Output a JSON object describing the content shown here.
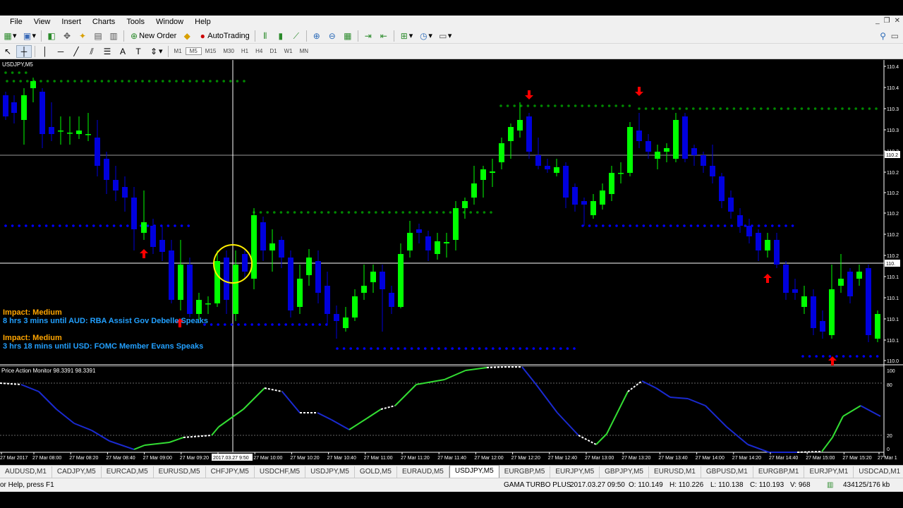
{
  "menu": [
    "File",
    "View",
    "Insert",
    "Charts",
    "Tools",
    "Window",
    "Help"
  ],
  "toolbar": {
    "new_order": "New Order",
    "auto_trading": "AutoTrading"
  },
  "timeframes": [
    "M1",
    "M5",
    "M15",
    "M30",
    "H1",
    "H4",
    "D1",
    "W1",
    "MN"
  ],
  "chart": {
    "symbol_label": "USDJPY,M5",
    "indicator_label": "Price Action Monitor 98.3391 98.3391",
    "news": [
      {
        "impact": "Impact: Medium",
        "text": "8 hrs 3 mins until AUD: RBA Assist Gov Debelle Speaks"
      },
      {
        "impact": "Impact: Medium",
        "text": "3 hrs 18 mins until USD: FOMC Member Evans Speaks"
      }
    ],
    "price_labels": [
      "110.4",
      "110.4",
      "110.3",
      "110.3",
      "110.2",
      "110.2",
      "110.2",
      "110.2",
      "110.2",
      "110.2",
      "110.1",
      "110.1",
      "110.1",
      "110.1",
      "110.0"
    ],
    "crosshair_price_label": "110.",
    "bid_price_label": "110.2",
    "indicator_levels": [
      "100",
      "80",
      "20",
      "0"
    ],
    "time_labels": [
      "27 Mar 2017",
      "27 Mar 08:00",
      "27 Mar 08:20",
      "27 Mar 08:40",
      "27 Mar 09:00",
      "27 Mar 09:20",
      "2017.03.27 9:50",
      "27 Mar 10:00",
      "27 Mar 10:20",
      "27 Mar 10:40",
      "27 Mar 11:00",
      "27 Mar 11:20",
      "27 Mar 11:40",
      "27 Mar 12:00",
      "27 Mar 12:20",
      "27 Mar 12:40",
      "27 Mar 13:00",
      "27 Mar 13:20",
      "27 Mar 13:40",
      "27 Mar 14:00",
      "27 Mar 14:20",
      "27 Mar 14:40",
      "27 Mar 15:00",
      "27 Mar 15:20",
      "27 Mar 1"
    ],
    "colors": {
      "bull": "#00ff00",
      "bear": "#0000dd",
      "resistance": "#008800",
      "support": "#0000ff",
      "signal": "#ff0000",
      "impact": "#ffa500",
      "news_text": "#22a0ff"
    }
  },
  "tabs": [
    "AUDUSD,M1",
    "CADJPY,M5",
    "EURCAD,M5",
    "EURUSD,M5",
    "CHFJPY,M5",
    "USDCHF,M5",
    "USDJPY,M5",
    "GOLD,M5",
    "EURAUD,M5",
    "USDJPY,M5",
    "EURGBP,M5",
    "EURJPY,M5",
    "GBPJPY,M5",
    "EURUSD,M1",
    "GBPUSD,M1",
    "EURGBP,M1",
    "EURJPY,M1",
    "USDCAD,M1"
  ],
  "active_tab_index": 9,
  "status": {
    "help": "or Help, press F1",
    "profile": "GAMA TURBO PLUS",
    "datetime": "2017.03.27 09:50",
    "open": "O: 110.149",
    "high": "H: 110.226",
    "low": "L: 110.138",
    "close": "C: 110.193",
    "volume": "V: 968",
    "traffic": "434125/176 kb"
  }
}
